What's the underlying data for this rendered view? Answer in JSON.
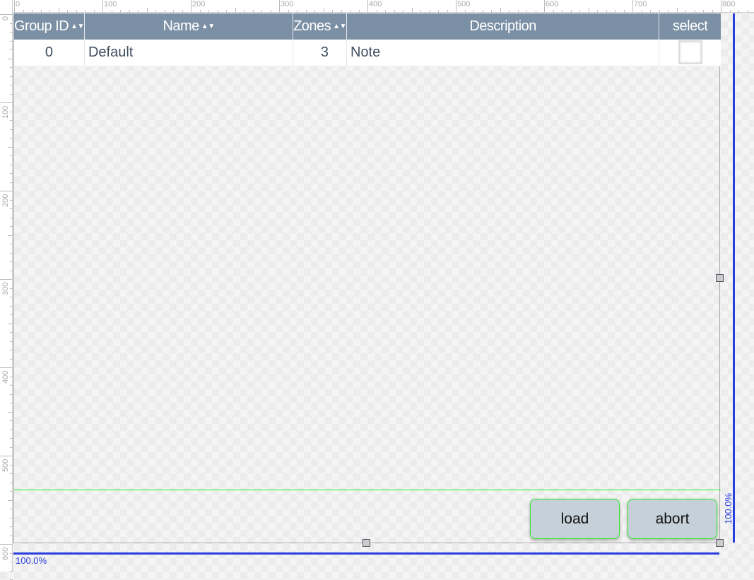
{
  "rulers": {
    "top_labels": [
      "0",
      "100",
      "200",
      "300",
      "400",
      "500",
      "600",
      "700",
      "800"
    ],
    "left_labels": [
      "0",
      "100",
      "200",
      "300",
      "400",
      "500",
      "600"
    ]
  },
  "table": {
    "columns": [
      {
        "label": "Group ID",
        "sortable": true
      },
      {
        "label": "Name",
        "sortable": true
      },
      {
        "label": "Zones",
        "sortable": true
      },
      {
        "label": "Description",
        "sortable": false
      },
      {
        "label": "select",
        "sortable": false
      }
    ],
    "rows": [
      {
        "group_id": "0",
        "name": "Default",
        "zones": "3",
        "description": "Note",
        "selected": false
      }
    ]
  },
  "buttons": {
    "load": "load",
    "abort": "abort"
  },
  "zoom": {
    "width_pct": "100.0%",
    "height_pct": "100.0%"
  },
  "colors": {
    "header": "#7b90a5",
    "button": "#c5d0d8",
    "measure": "#2a3fe0",
    "guide": "#2ee82e"
  }
}
